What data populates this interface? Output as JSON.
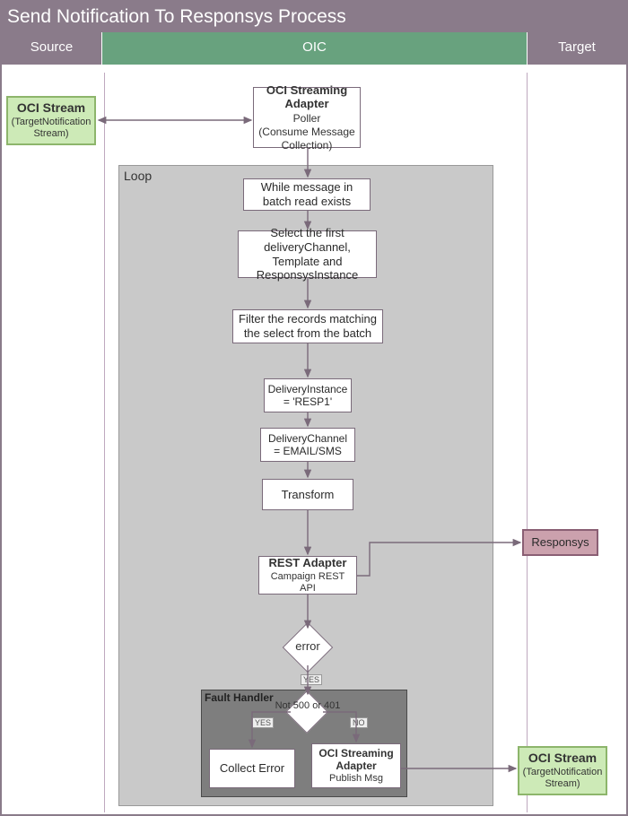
{
  "title": "Send Notification To Responsys Process",
  "columns": {
    "source": "Source",
    "oic": "OIC",
    "target": "Target"
  },
  "source_stream": {
    "t": "OCI Stream",
    "s": "(TargetNotification Stream)"
  },
  "adapter": {
    "t": "OCI Streaming Adapter",
    "s1": "Poller",
    "s2": "(Consume Message Collection)"
  },
  "loop_label": "Loop",
  "steps": {
    "while": "While message in batch read exists",
    "select": "Select the first deliveryChannel, Template and ResponsysInstance",
    "filter": "Filter the records matching the select from the batch",
    "inst": "DeliveryInstance = 'RESP1'",
    "chan": "DeliveryChannel = EMAIL/SMS",
    "transform": "Transform",
    "rest_t": "REST Adapter",
    "rest_s": "Campaign REST API",
    "error": "error",
    "not500": "Not 500 or 401",
    "collect": "Collect Error",
    "publish_t": "OCI Streaming Adapter",
    "publish_s": "Publish Msg"
  },
  "target": {
    "responsys": "Responsys",
    "stream_t": "OCI Stream",
    "stream_s": "(TargetNotification Stream)"
  },
  "fault_label": "Fault Handler",
  "yes": "YES",
  "no": "NO"
}
